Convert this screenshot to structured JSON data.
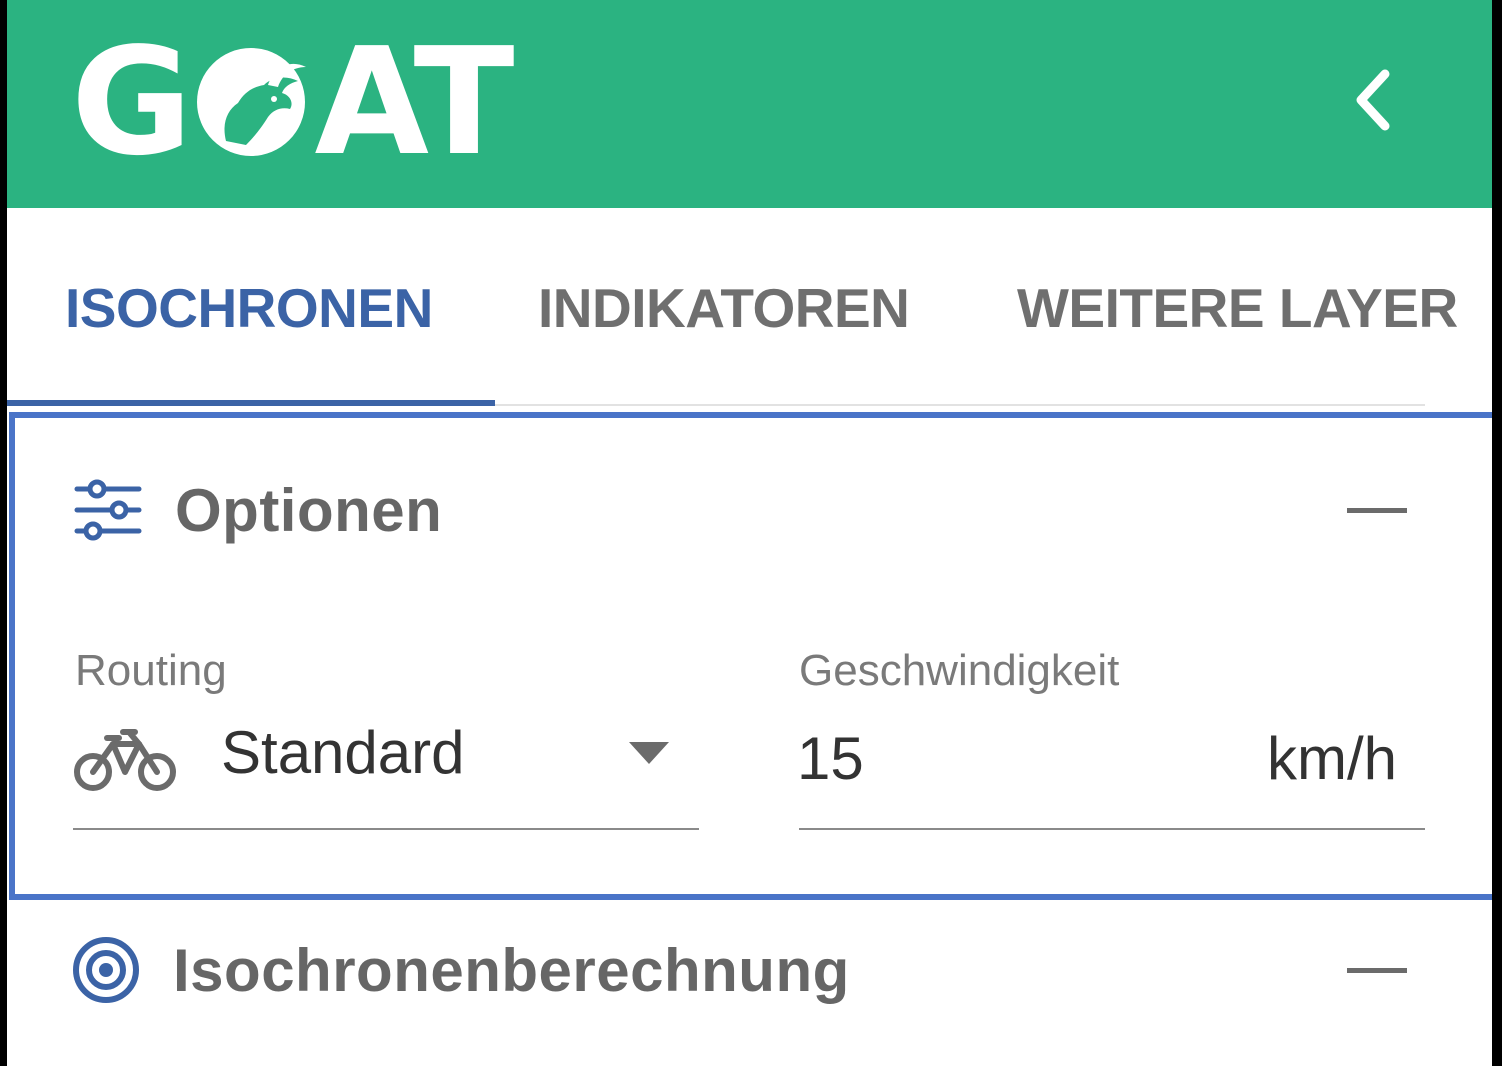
{
  "header": {
    "logo_text_left": "G",
    "logo_text_right": "AT",
    "logo_mark": "goat-head-icon",
    "collapse_icon": "chevron-left-icon",
    "background_color": "#2bb381"
  },
  "tabs": [
    {
      "label": "ISOCHRONEN",
      "active": true
    },
    {
      "label": "INDIKATOREN",
      "active": false
    },
    {
      "label": "WEITERE LAYER",
      "active": false
    }
  ],
  "options": {
    "title": "Optionen",
    "icon": "sliders-icon",
    "collapse_icon": "minus-icon",
    "routing": {
      "label": "Routing",
      "value": "Standard",
      "icon": "bicycle-icon"
    },
    "speed": {
      "label": "Geschwindigkeit",
      "value": "15",
      "unit": "km/h"
    },
    "highlight_color": "#4a74c8"
  },
  "isochrone_calc": {
    "title": "Isochronenberechnung",
    "icon": "target-icon",
    "collapse_icon": "minus-icon"
  },
  "colors": {
    "accent": "#3b63a6",
    "brand": "#2bb381"
  }
}
